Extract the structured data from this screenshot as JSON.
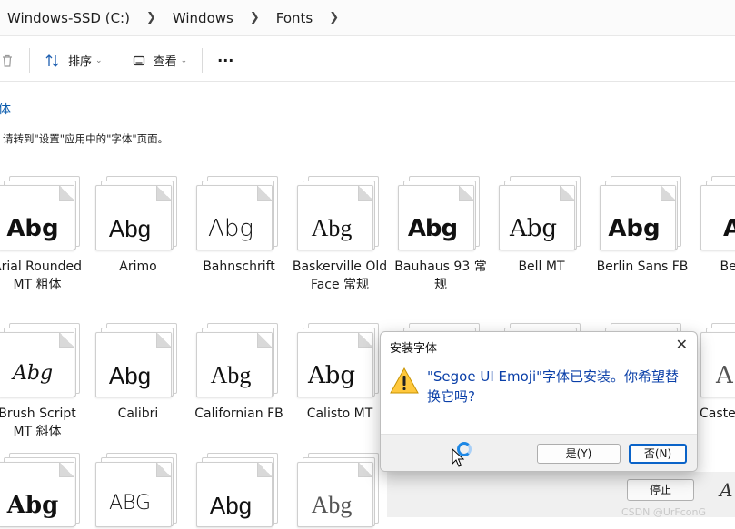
{
  "breadcrumb": [
    "Windows-SSD (C:)",
    "Windows",
    "Fonts"
  ],
  "toolbar": {
    "sort_label": "排序",
    "view_label": "查看",
    "more_label": "···"
  },
  "page": {
    "heading_fragment": "体",
    "note": "请转到\"设置\"应用中的\"字体\"页面。"
  },
  "fonts": [
    {
      "sample": "Abg",
      "label": "Arial Rounded MT 粗体"
    },
    {
      "sample": "Abg",
      "label": "Arimo"
    },
    {
      "sample": "Abg",
      "label": "Bahnschrift"
    },
    {
      "sample": "Abg",
      "label": "Baskerville Old Face 常规"
    },
    {
      "sample": "Abg",
      "label": "Bauhaus 93 常规"
    },
    {
      "sample": "Abg",
      "label": "Bell MT"
    },
    {
      "sample": "Abg",
      "label": "Berlin Sans FB"
    },
    {
      "sample": "A",
      "label": "Bern 粗"
    },
    {
      "sample": "Abg",
      "label": "Brush Script MT 斜体"
    },
    {
      "sample": "Abg",
      "label": "Calibri"
    },
    {
      "sample": "Abg",
      "label": "Californian FB"
    },
    {
      "sample": "Abg",
      "label": "Calisto MT"
    },
    {
      "sample": "A",
      "label": "Caste"
    },
    {
      "sample": "Abg",
      "label": ""
    },
    {
      "sample": "ABG",
      "label": ""
    },
    {
      "sample": "Abg",
      "label": ""
    },
    {
      "sample": "Abg",
      "label": ""
    },
    {
      "sample": "A",
      "label": ""
    }
  ],
  "dialog": {
    "title": "安装字体",
    "close_glyph": "✕",
    "message": "\"Segoe UI Emoji\"字体已安装。你希望替换它吗?",
    "yes_label": "是(Y)",
    "no_label": "否(N)"
  },
  "background_dialog": {
    "stop_label": "停止"
  },
  "watermark": "CSDN @UrFconG"
}
